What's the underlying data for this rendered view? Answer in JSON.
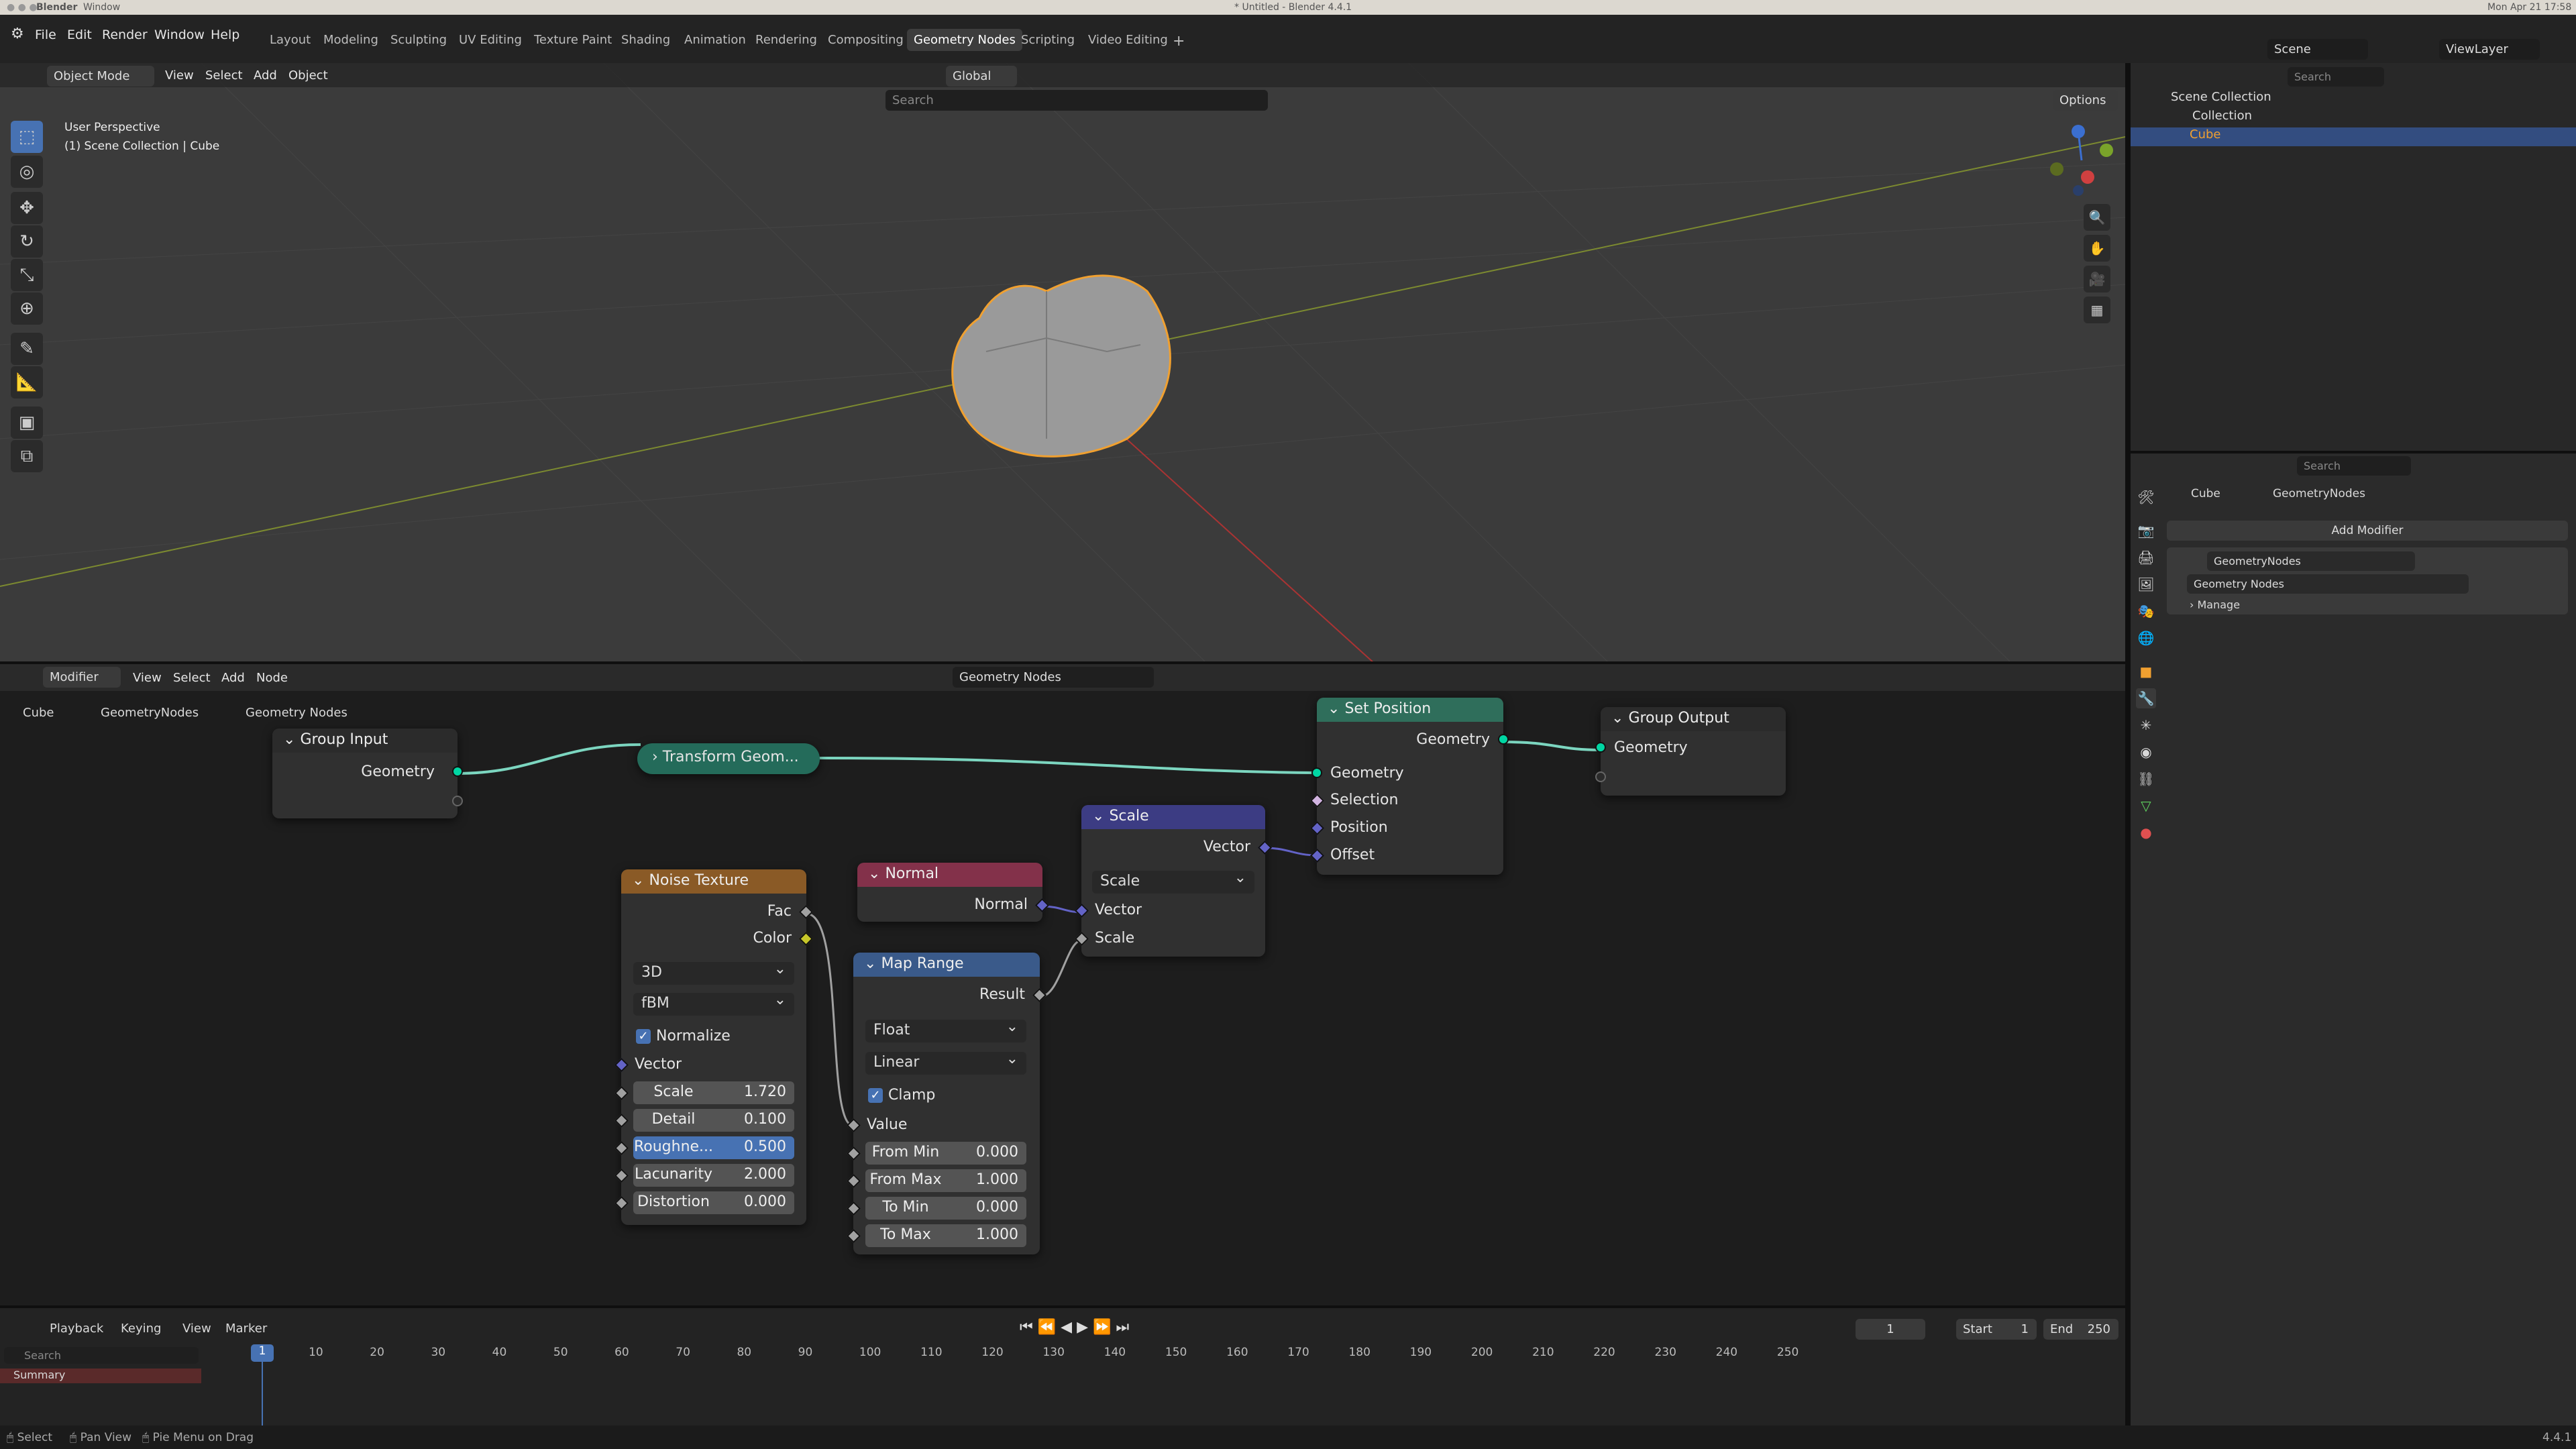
{
  "mac": {
    "app": "Blender",
    "window": "Window",
    "datetime": "Mon Apr 21 17:58"
  },
  "title": "* Untitled - Blender 4.4.1",
  "menus": [
    "File",
    "Edit",
    "Render",
    "Window",
    "Help"
  ],
  "workspaces": [
    "Layout",
    "Modeling",
    "Sculpting",
    "UV Editing",
    "Texture Paint",
    "Shading",
    "Animation",
    "Rendering",
    "Compositing",
    "Geometry Nodes",
    "Scripting",
    "Video Editing"
  ],
  "active_workspace": "Geometry Nodes",
  "scene": "Scene",
  "viewlayer": "ViewLayer",
  "viewport": {
    "mode": "Object Mode",
    "menus": [
      "View",
      "Select",
      "Add",
      "Object"
    ],
    "orientation": "Global",
    "search": "Search",
    "options": "Options",
    "overlay_title": "User Perspective",
    "overlay_sub": "(1) Scene Collection | Cube"
  },
  "node_editor": {
    "editor": "Modifier",
    "menus": [
      "View",
      "Select",
      "Add",
      "Node"
    ],
    "tree": "Geometry Nodes",
    "breadcrumb": [
      "Cube",
      "GeometryNodes",
      "Geometry Nodes"
    ]
  },
  "nodes": {
    "group_input": {
      "title": "Group Input",
      "out": "Geometry"
    },
    "transform": {
      "title": "Transform Geom..."
    },
    "set_position": {
      "title": "Set Position",
      "out": "Geometry",
      "inputs": [
        "Geometry",
        "Selection",
        "Position",
        "Offset"
      ]
    },
    "group_output": {
      "title": "Group Output",
      "in": "Geometry"
    },
    "scale": {
      "title": "Scale",
      "out": "Vector",
      "mode": "Scale",
      "inputs": [
        "Vector",
        "Scale"
      ]
    },
    "normal": {
      "title": "Normal",
      "out": "Normal"
    },
    "noise": {
      "title": "Noise Texture",
      "outs": [
        "Fac",
        "Color"
      ],
      "dim": "3D",
      "type": "fBM",
      "normalize": "Normalize",
      "vector": "Vector",
      "fields": [
        {
          "label": "Scale",
          "value": "1.720"
        },
        {
          "label": "Detail",
          "value": "0.100"
        },
        {
          "label": "Roughne...",
          "value": "0.500"
        },
        {
          "label": "Lacunarity",
          "value": "2.000"
        },
        {
          "label": "Distortion",
          "value": "0.000"
        }
      ]
    },
    "map_range": {
      "title": "Map Range",
      "out": "Result",
      "dtype": "Float",
      "interp": "Linear",
      "clamp": "Clamp",
      "value": "Value",
      "fields": [
        {
          "label": "From Min",
          "value": "0.000"
        },
        {
          "label": "From Max",
          "value": "1.000"
        },
        {
          "label": "To Min",
          "value": "0.000"
        },
        {
          "label": "To Max",
          "value": "1.000"
        }
      ]
    }
  },
  "timeline": {
    "menus": [
      "Playback",
      "Keying",
      "View",
      "Marker"
    ],
    "current": "1",
    "start_label": "Start",
    "start": "1",
    "end_label": "End",
    "end": "250",
    "ticks": [
      "1",
      "10",
      "20",
      "30",
      "40",
      "50",
      "60",
      "70",
      "80",
      "90",
      "100",
      "110",
      "120",
      "130",
      "140",
      "150",
      "160",
      "170",
      "180",
      "190",
      "200",
      "210",
      "220",
      "230",
      "240",
      "250"
    ],
    "search": "Search",
    "summary": "Summary"
  },
  "outliner": {
    "search": "Search",
    "rows": [
      "Scene Collection",
      "Collection",
      "Cube"
    ]
  },
  "properties": {
    "search": "Search",
    "breadcrumb": [
      "Cube",
      "GeometryNodes"
    ],
    "add_modifier": "Add Modifier",
    "modifier_name": "GeometryNodes",
    "group": "Geometry Nodes",
    "manage": "Manage"
  },
  "status": {
    "select": "Select",
    "pan": "Pan View",
    "pie": "Pie Menu on Drag",
    "version": "4.4.1"
  },
  "colors": {
    "geometry": "#00d6a3",
    "vector": "#6363c7",
    "float": "#a1a1a1",
    "color": "#c7c729",
    "select": "#4772b3"
  }
}
